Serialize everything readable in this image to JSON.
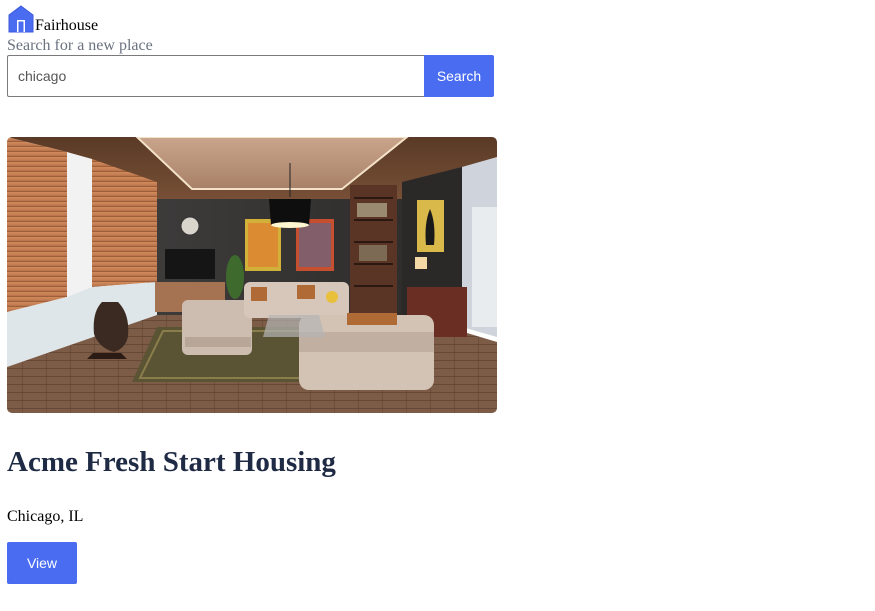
{
  "header": {
    "brand_name": "Fairhouse",
    "logo_icon": "house-icon",
    "accent_color": "#4a6cf0"
  },
  "search": {
    "label": "Search for a new place",
    "value": "chicago",
    "placeholder": "",
    "button_label": "Search"
  },
  "listing": {
    "image_icon": "living-room-photo",
    "title": "Acme Fresh Start Housing",
    "location": "Chicago, IL",
    "view_label": "View"
  }
}
